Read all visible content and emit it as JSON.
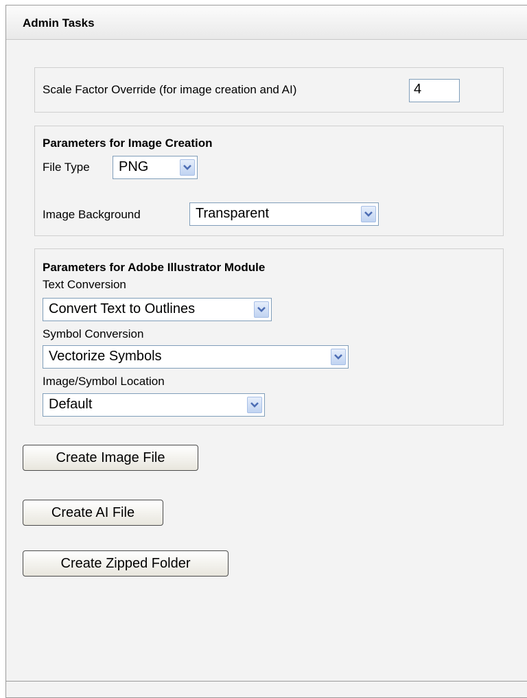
{
  "panel": {
    "title": "Admin Tasks"
  },
  "scale": {
    "label": "Scale Factor Override (for image creation and AI)",
    "value": "4"
  },
  "image_params": {
    "heading": "Parameters for Image Creation",
    "file_type_label": "File Type",
    "file_type_value": "PNG",
    "background_label": "Image Background",
    "background_value": "Transparent"
  },
  "ai_params": {
    "heading": "Parameters for Adobe Illustrator Module",
    "text_conv_label": "Text Conversion",
    "text_conv_value": "Convert Text to Outlines",
    "symbol_conv_label": "Symbol Conversion",
    "symbol_conv_value": "Vectorize Symbols",
    "location_label": "Image/Symbol Location",
    "location_value": "Default"
  },
  "buttons": {
    "create_image": "Create Image File",
    "create_ai": "Create AI File",
    "create_zip": "Create Zipped Folder"
  },
  "icons": {
    "dropdown": "chevron-down-icon"
  },
  "colors": {
    "input_border": "#7f9db9",
    "arrow_blue": "#4d6db4"
  }
}
